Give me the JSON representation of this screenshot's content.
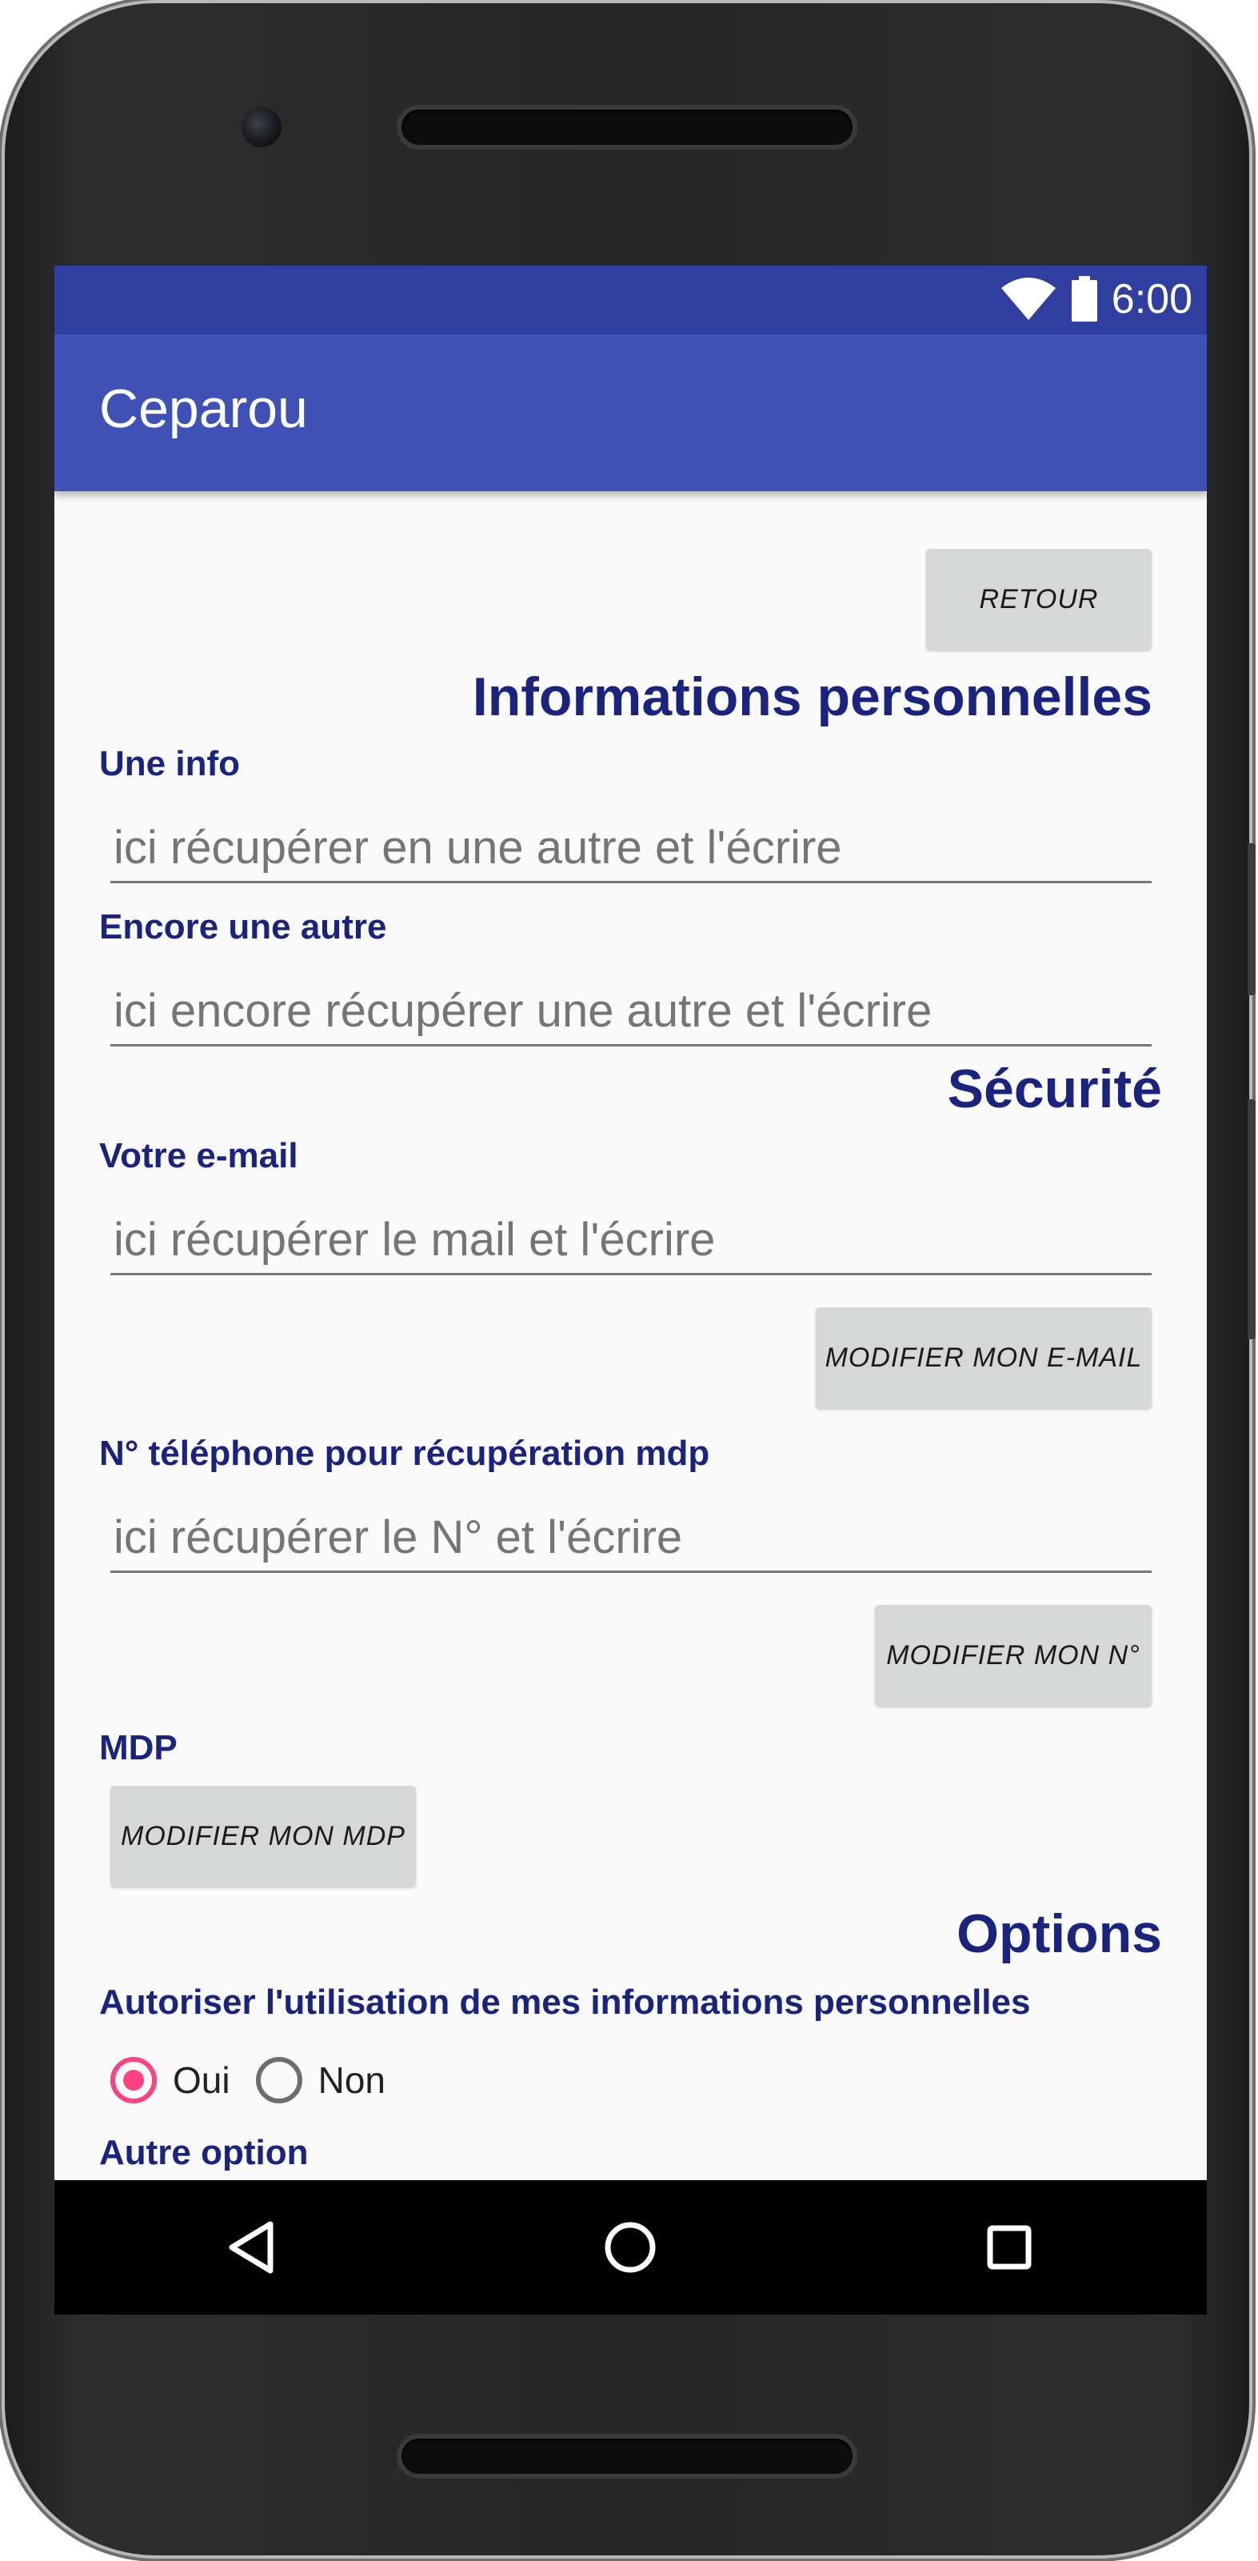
{
  "status_bar": {
    "time": "6:00",
    "wifi_icon": "wifi-icon",
    "battery_icon": "battery-icon",
    "color": "#303f9f"
  },
  "app_bar": {
    "title": "Ceparou",
    "color": "#3f51b5"
  },
  "actions": {
    "back_label": "RETOUR"
  },
  "personal_info": {
    "section_title": "Informations personnelles",
    "field1_label": "Une  info",
    "field1_value": "ici récupérer en une autre et l'écrire",
    "field2_label": "Encore une autre",
    "field2_value": "ici encore récupérer une autre et l'écrire"
  },
  "security": {
    "section_title": "Sécurité",
    "email_label": "Votre e-mail",
    "email_value": "ici récupérer le mail et l'écrire",
    "email_button": "MODIFIER MON E-MAIL",
    "phone_label": "N° téléphone pour récupération mdp",
    "phone_value": "ici récupérer le N° et l'écrire",
    "phone_button": "MODIFIER MON N°",
    "password_label": "MDP",
    "password_button": "MODIFIER MON MDP"
  },
  "options": {
    "section_title": "Options",
    "consent_label": "Autoriser l'utilisation de mes informations personnelles",
    "radio_yes": "Oui",
    "radio_no": "Non",
    "selected": "Oui",
    "next_label": "Autre option",
    "accent_color": "#ff4081",
    "heading_color": "#1a237e"
  },
  "nav_bar": {
    "back_icon": "back-triangle-icon",
    "home_icon": "home-circle-icon",
    "recents_icon": "recents-square-icon"
  }
}
